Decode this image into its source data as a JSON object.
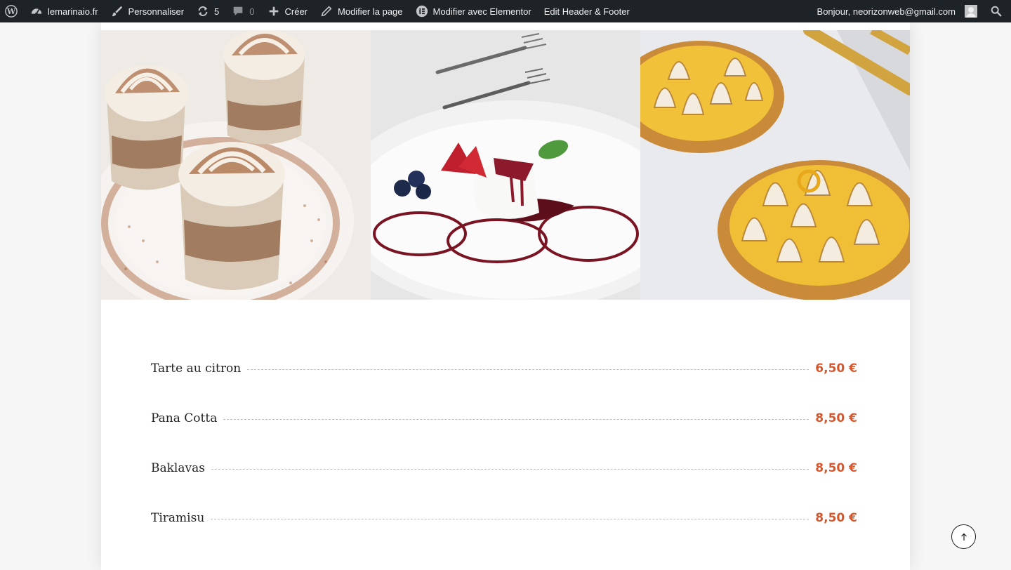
{
  "adminbar": {
    "site_name": "lemarinaio.fr",
    "customize": "Personnaliser",
    "updates_count": "5",
    "comments_count": "0",
    "new": "Créer",
    "edit_page": "Modifier la page",
    "elementor": "Modifier avec Elementor",
    "edit_header_footer": "Edit Header & Footer",
    "greeting": "Bonjour, neorizonweb@gmail.com",
    "icons": [
      "wordpress-icon",
      "dashboard-icon",
      "brush-icon",
      "updates-icon",
      "comment-icon",
      "plus-icon",
      "pencil-icon",
      "elementor-icon",
      "avatar",
      "search-icon"
    ]
  },
  "gallery": {
    "photos": [
      "tiramisu-glasses",
      "panna-cotta-plate",
      "lemon-meringue-tarts"
    ]
  },
  "menu": {
    "items": [
      {
        "name": "Tarte au citron",
        "price": "6,50 €"
      },
      {
        "name": "Pana Cotta",
        "price": "8,50 €"
      },
      {
        "name": "Baklavas",
        "price": "8,50 €"
      },
      {
        "name": "Tiramisu",
        "price": "8,50 €"
      }
    ]
  },
  "colors": {
    "admin_bar": "#1d2327",
    "price_accent": "#d9562b",
    "text_dark": "#1f1f1f"
  }
}
